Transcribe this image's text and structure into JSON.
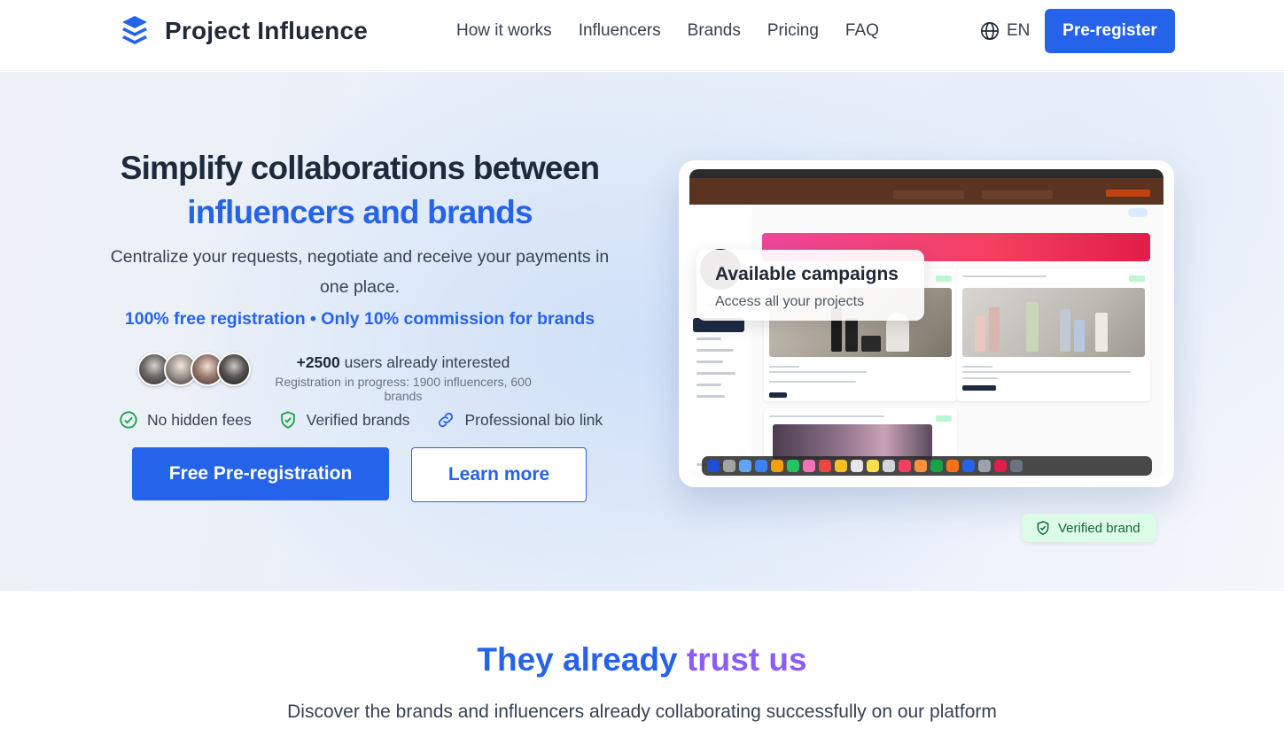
{
  "brand": {
    "name": "Project Influence"
  },
  "nav": {
    "links": [
      "How it works",
      "Influencers",
      "Brands",
      "Pricing",
      "FAQ"
    ],
    "language": "EN",
    "cta_label": "Pre-register"
  },
  "hero": {
    "title_line1": "Simplify collaborations between",
    "title_line2": "influencers and brands",
    "subtitle": "Centralize your requests, negotiate and receive your payments in one place.",
    "free_line": "100% free registration • Only 10% commission for brands",
    "users_count": "+2500",
    "users_text": " users already interested",
    "users_sub": "Registration in progress: 1900 influencers, 600 brands",
    "features": [
      "No hidden fees",
      "Verified brands",
      "Professional bio link"
    ],
    "primary_button": "Free Pre-registration",
    "secondary_button": "Learn more",
    "overlay_title": "Available campaigns",
    "overlay_sub": "Access all your projects",
    "badge": "Verified brand"
  },
  "trust": {
    "title_part1": "They already",
    "title_part2": "trust",
    "title_part3": "us",
    "subtitle": "Discover the brands and influencers already collaborating successfully on our platform"
  },
  "colors": {
    "accent": "#2563eb",
    "success": "#16a34a",
    "purple": "#8b5cf6"
  }
}
